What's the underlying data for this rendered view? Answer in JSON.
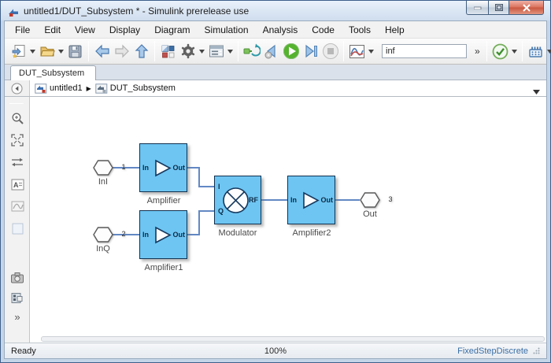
{
  "window": {
    "title": "untitled1/DUT_Subsystem * - Simulink prerelease use"
  },
  "menu": {
    "items": [
      "File",
      "Edit",
      "View",
      "Display",
      "Diagram",
      "Simulation",
      "Analysis",
      "Code",
      "Tools",
      "Help"
    ]
  },
  "toolbar": {
    "stop_time": "inf",
    "overflow": "»"
  },
  "tab": {
    "label": "DUT_Subsystem"
  },
  "breadcrumb": {
    "model": "untitled1",
    "separator": "▶",
    "subsystem": "DUT_Subsystem"
  },
  "palette": {
    "more": "»"
  },
  "diagram": {
    "inports": [
      {
        "number": "1",
        "label": "InI"
      },
      {
        "number": "2",
        "label": "InQ"
      }
    ],
    "outport": {
      "number": "3",
      "label": "Out"
    },
    "blocks": {
      "amplifier": {
        "name": "Amplifier",
        "in": "In",
        "out": "Out"
      },
      "amplifier1": {
        "name": "Amplifier1",
        "in": "In",
        "out": "Out"
      },
      "amplifier2": {
        "name": "Amplifier2",
        "in": "In",
        "out": "Out"
      },
      "modulator": {
        "name": "Modulator",
        "i": "I",
        "q": "Q",
        "rf": "RF"
      }
    }
  },
  "statusbar": {
    "status": "Ready",
    "zoom": "100%",
    "solver": "FixedStepDiscrete"
  },
  "colors": {
    "block_fill": "#6EC5F2",
    "block_border": "#11314F",
    "wire": "#6288C4",
    "solver_text": "#3A6EA5"
  }
}
